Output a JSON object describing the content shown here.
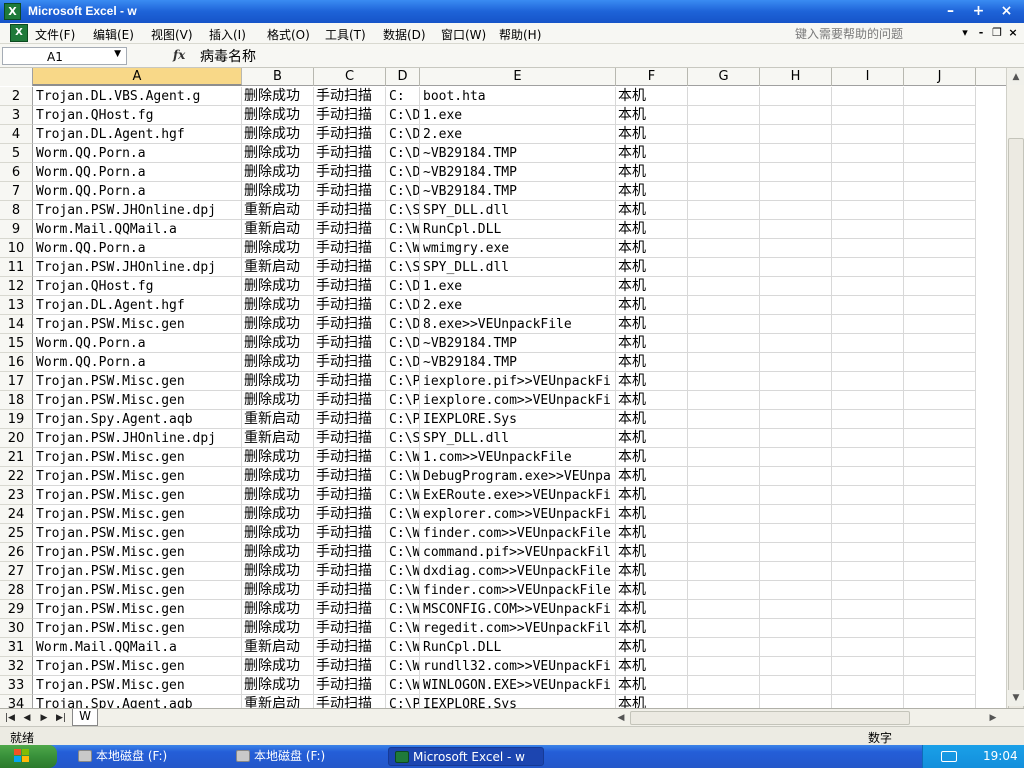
{
  "window": {
    "title": "Microsoft Excel - w"
  },
  "menu": {
    "items": [
      "文件(F)",
      "编辑(E)",
      "视图(V)",
      "插入(I)",
      "格式(O)",
      "工具(T)",
      "数据(D)",
      "窗口(W)",
      "帮助(H)"
    ],
    "help_placeholder": "键入需要帮助的问题"
  },
  "formula_bar": {
    "name_box": "A1",
    "fx": "fx",
    "content": "病毒名称"
  },
  "columns": [
    "A",
    "B",
    "C",
    "D",
    "E",
    "F",
    "G",
    "H",
    "I",
    "J"
  ],
  "rows": [
    {
      "n": "2",
      "a": "Trojan.DL.VBS.Agent.g",
      "b": "删除成功",
      "c": "手动扫描",
      "d": "C:",
      "e": "boot.hta",
      "f": "本机"
    },
    {
      "n": "3",
      "a": "Trojan.QHost.fg",
      "b": "删除成功",
      "c": "手动扫描",
      "d": "C:\\D",
      "e": "1.exe",
      "f": "本机"
    },
    {
      "n": "4",
      "a": "Trojan.DL.Agent.hgf",
      "b": "删除成功",
      "c": "手动扫描",
      "d": "C:\\D",
      "e": "2.exe",
      "f": "本机"
    },
    {
      "n": "5",
      "a": "Worm.QQ.Porn.a",
      "b": "删除成功",
      "c": "手动扫描",
      "d": "C:\\D",
      "e": "~VB29184.TMP",
      "f": "本机"
    },
    {
      "n": "6",
      "a": "Worm.QQ.Porn.a",
      "b": "删除成功",
      "c": "手动扫描",
      "d": "C:\\D",
      "e": "~VB29184.TMP",
      "f": "本机"
    },
    {
      "n": "7",
      "a": "Worm.QQ.Porn.a",
      "b": "删除成功",
      "c": "手动扫描",
      "d": "C:\\D",
      "e": "~VB29184.TMP",
      "f": "本机"
    },
    {
      "n": "8",
      "a": "Trojan.PSW.JHOnline.dpj",
      "b": "重新启动",
      "c": "手动扫描",
      "d": "C:\\S",
      "e": "SPY_DLL.dll",
      "f": "本机"
    },
    {
      "n": "9",
      "a": "Worm.Mail.QQMail.a",
      "b": "重新启动",
      "c": "手动扫描",
      "d": "C:\\W",
      "e": "RunCpl.DLL",
      "f": "本机"
    },
    {
      "n": "10",
      "a": "Worm.QQ.Porn.a",
      "b": "删除成功",
      "c": "手动扫描",
      "d": "C:\\W",
      "e": "wmimgry.exe",
      "f": "本机"
    },
    {
      "n": "11",
      "a": "Trojan.PSW.JHOnline.dpj",
      "b": "重新启动",
      "c": "手动扫描",
      "d": "C:\\S",
      "e": "SPY_DLL.dll",
      "f": "本机"
    },
    {
      "n": "12",
      "a": "Trojan.QHost.fg",
      "b": "删除成功",
      "c": "手动扫描",
      "d": "C:\\D",
      "e": "1.exe",
      "f": "本机"
    },
    {
      "n": "13",
      "a": "Trojan.DL.Agent.hgf",
      "b": "删除成功",
      "c": "手动扫描",
      "d": "C:\\D",
      "e": "2.exe",
      "f": "本机"
    },
    {
      "n": "14",
      "a": "Trojan.PSW.Misc.gen",
      "b": "删除成功",
      "c": "手动扫描",
      "d": "C:\\D",
      "e": "8.exe>>VEUnpackFile",
      "f": "本机"
    },
    {
      "n": "15",
      "a": "Worm.QQ.Porn.a",
      "b": "删除成功",
      "c": "手动扫描",
      "d": "C:\\D",
      "e": "~VB29184.TMP",
      "f": "本机"
    },
    {
      "n": "16",
      "a": "Worm.QQ.Porn.a",
      "b": "删除成功",
      "c": "手动扫描",
      "d": "C:\\D",
      "e": "~VB29184.TMP",
      "f": "本机"
    },
    {
      "n": "17",
      "a": "Trojan.PSW.Misc.gen",
      "b": "删除成功",
      "c": "手动扫描",
      "d": "C:\\P",
      "e": "iexplore.pif>>VEUnpackFi",
      "f": "本机"
    },
    {
      "n": "18",
      "a": "Trojan.PSW.Misc.gen",
      "b": "删除成功",
      "c": "手动扫描",
      "d": "C:\\P",
      "e": "iexplore.com>>VEUnpackFi",
      "f": "本机"
    },
    {
      "n": "19",
      "a": "Trojan.Spy.Agent.aqb",
      "b": "重新启动",
      "c": "手动扫描",
      "d": "C:\\P",
      "e": "IEXPLORE.Sys",
      "f": "本机"
    },
    {
      "n": "20",
      "a": "Trojan.PSW.JHOnline.dpj",
      "b": "重新启动",
      "c": "手动扫描",
      "d": "C:\\S",
      "e": "SPY_DLL.dll",
      "f": "本机"
    },
    {
      "n": "21",
      "a": "Trojan.PSW.Misc.gen",
      "b": "删除成功",
      "c": "手动扫描",
      "d": "C:\\W",
      "e": "1.com>>VEUnpackFile",
      "f": "本机"
    },
    {
      "n": "22",
      "a": "Trojan.PSW.Misc.gen",
      "b": "删除成功",
      "c": "手动扫描",
      "d": "C:\\W",
      "e": "DebugProgram.exe>>VEUnpa",
      "f": "本机"
    },
    {
      "n": "23",
      "a": "Trojan.PSW.Misc.gen",
      "b": "删除成功",
      "c": "手动扫描",
      "d": "C:\\W",
      "e": "ExERoute.exe>>VEUnpackFi",
      "f": "本机"
    },
    {
      "n": "24",
      "a": "Trojan.PSW.Misc.gen",
      "b": "删除成功",
      "c": "手动扫描",
      "d": "C:\\W",
      "e": "explorer.com>>VEUnpackFi",
      "f": "本机"
    },
    {
      "n": "25",
      "a": "Trojan.PSW.Misc.gen",
      "b": "删除成功",
      "c": "手动扫描",
      "d": "C:\\W",
      "e": "finder.com>>VEUnpackFile",
      "f": "本机"
    },
    {
      "n": "26",
      "a": "Trojan.PSW.Misc.gen",
      "b": "删除成功",
      "c": "手动扫描",
      "d": "C:\\W",
      "e": "command.pif>>VEUnpackFil",
      "f": "本机"
    },
    {
      "n": "27",
      "a": "Trojan.PSW.Misc.gen",
      "b": "删除成功",
      "c": "手动扫描",
      "d": "C:\\W",
      "e": "dxdiag.com>>VEUnpackFile",
      "f": "本机"
    },
    {
      "n": "28",
      "a": "Trojan.PSW.Misc.gen",
      "b": "删除成功",
      "c": "手动扫描",
      "d": "C:\\W",
      "e": "finder.com>>VEUnpackFile",
      "f": "本机"
    },
    {
      "n": "29",
      "a": "Trojan.PSW.Misc.gen",
      "b": "删除成功",
      "c": "手动扫描",
      "d": "C:\\W",
      "e": "MSCONFIG.COM>>VEUnpackFi",
      "f": "本机"
    },
    {
      "n": "30",
      "a": "Trojan.PSW.Misc.gen",
      "b": "删除成功",
      "c": "手动扫描",
      "d": "C:\\W",
      "e": "regedit.com>>VEUnpackFil",
      "f": "本机"
    },
    {
      "n": "31",
      "a": "Worm.Mail.QQMail.a",
      "b": "重新启动",
      "c": "手动扫描",
      "d": "C:\\W",
      "e": "RunCpl.DLL",
      "f": "本机"
    },
    {
      "n": "32",
      "a": "Trojan.PSW.Misc.gen",
      "b": "删除成功",
      "c": "手动扫描",
      "d": "C:\\W",
      "e": "rundll32.com>>VEUnpackFi",
      "f": "本机"
    },
    {
      "n": "33",
      "a": "Trojan.PSW.Misc.gen",
      "b": "删除成功",
      "c": "手动扫描",
      "d": "C:\\W",
      "e": "WINLOGON.EXE>>VEUnpackFi",
      "f": "本机"
    },
    {
      "n": "34",
      "a": "Trojan.Spy.Agent.aqb",
      "b": "重新启动",
      "c": "手动扫描",
      "d": "C:\\P",
      "e": "IEXPLORE.Sys",
      "f": "本机"
    }
  ],
  "sheet_tab": "W",
  "status": {
    "left": "就绪",
    "right": "数字"
  },
  "taskbar": {
    "tasks": [
      "本地磁盘 (F:)",
      "本地磁盘 (F:)",
      "Microsoft Excel - w"
    ],
    "clock": "19:04"
  },
  "colors": {
    "title_blue": "#1e63d8",
    "selected_header": "#f8d888",
    "taskbar_blue": "#245ed8",
    "start_green": "#38903a"
  }
}
